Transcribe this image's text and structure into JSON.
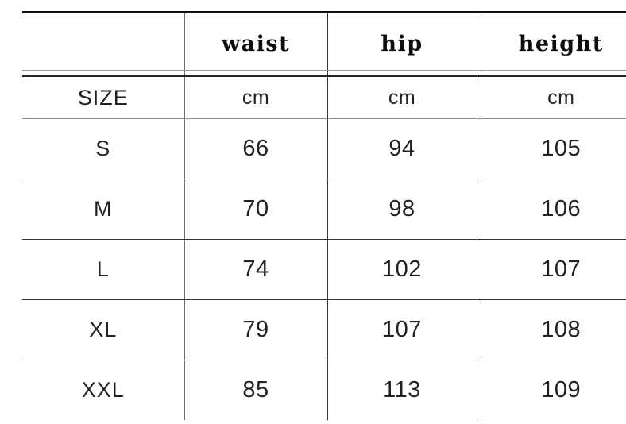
{
  "table": {
    "corner_label": "",
    "headers": [
      {
        "key": "size",
        "label": ""
      },
      {
        "key": "waist",
        "label": "waist"
      },
      {
        "key": "hip",
        "label": "hip"
      },
      {
        "key": "height",
        "label": "height"
      }
    ],
    "unit_row": {
      "size": "SIZE",
      "waist": "cm",
      "hip": "cm",
      "height": "cm"
    },
    "rows": [
      {
        "size": "S",
        "waist": "66",
        "hip": "94",
        "height": "105"
      },
      {
        "size": "M",
        "waist": "70",
        "hip": "98",
        "height": "106"
      },
      {
        "size": "L",
        "waist": "74",
        "hip": "102",
        "height": "107"
      },
      {
        "size": "XL",
        "waist": "79",
        "hip": "107",
        "height": "108"
      },
      {
        "size": "XXL",
        "waist": "85",
        "hip": "113",
        "height": "109"
      }
    ]
  },
  "colors": {
    "background": "#ffffff",
    "text": "#222222",
    "header_text": "#0d0d0d",
    "border_heavy": "#111111",
    "border_medium": "#333333",
    "border_light": "#8f8f8f"
  }
}
